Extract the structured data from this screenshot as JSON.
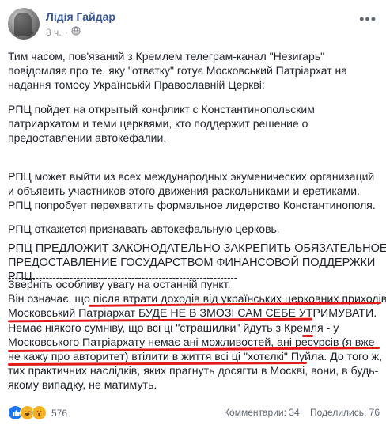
{
  "post": {
    "author": "Лідія Гайдар",
    "time": "8 ч.",
    "menu": "•••"
  },
  "text": {
    "p1": [
      "Тим часом, пов'язаний з Кремлем телеграм-канал \"Незигарь\"",
      "повідомляє про те, яку \"отвєтку\" готує Московський Патріархат на",
      "надання томосу Українській Православній Церкві:"
    ],
    "p2": [
      "РПЦ пойдет на открытый конфликт с Константинопольским",
      "патриархатом и теми церквями, кто поддержит решение о",
      "предоставлении автокефалии."
    ],
    "p3": [
      "РПЦ может выйти из всех международных экуменических организаций",
      "и объявить участников этого движения раскольниками и еретиками."
    ],
    "p4": "РПЦ попробует перехватить формальное лидерство Константинополя.",
    "p5": "РПЦ откажется признавать автокефальную церковь.",
    "p6": [
      "РПЦ ПРЕДЛОЖИТ ЗАКОНОДАТЕЛЬНО ЗАКРЕПИТЬ ОБЯЗАТЕЛЬНОЕ",
      "ПРЕДОСТАВЛЕНИЕ ГОСУДАРСТВОМ ФИНАНСОВОЙ ПОДДЕРЖКИ",
      "РПЦ."
    ],
    "separator": "-------------------------------------------------------------------",
    "p7": [
      "Зверніть особливу увагу на останній пункт.",
      "Він означає, що після втрати доходів від українських церковних приходів",
      "Московський Патріархат БУДЕ НЕ В ЗМОЗІ САМ СЕБЕ УТРИМУВАТИ.",
      "Немає ніякого сумніву, що всі ці \"страшилки\" йдуть з Кремля - у",
      "Московського Патріархату немає ані можливостей, ані ресурсів (я вже",
      "не кажу про авторитет) втілити в життя всі ці \"хотєлкі\" Пуйла. До того ж,",
      "тих практичних наслідків, яких прагнуть досягти в Москві, вони, в будь-",
      "якому випадку, не матимуть."
    ]
  },
  "footer": {
    "reaction_count": "576",
    "comments": "Комментарии: 34",
    "shares": "Поделились: 76"
  },
  "colors": {
    "link": "#385898",
    "underline": "#e41b1b",
    "text": "#1d2129"
  }
}
